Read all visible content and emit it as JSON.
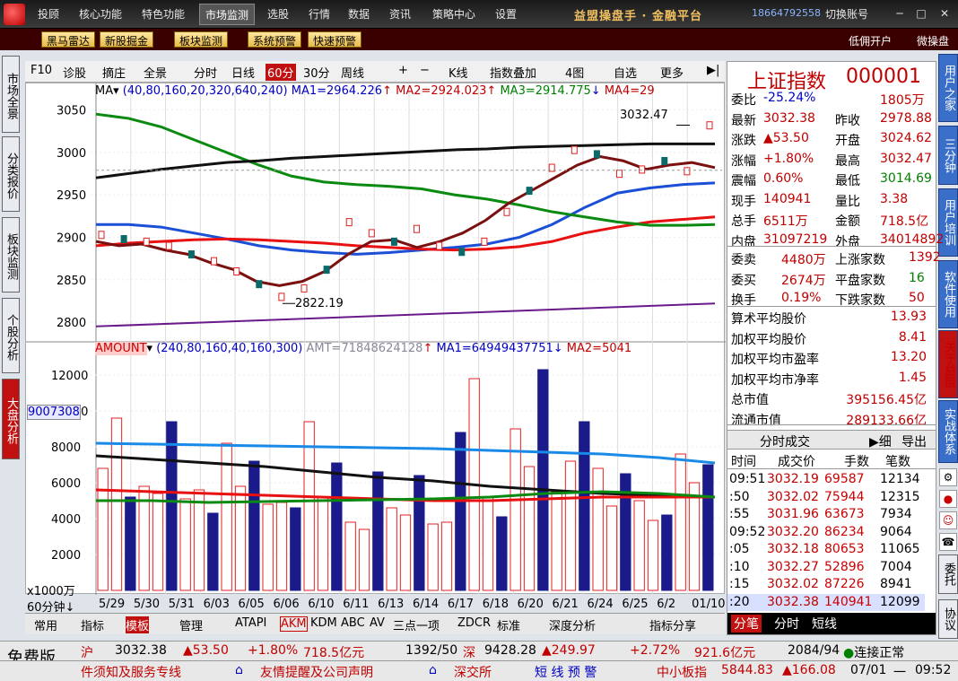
{
  "topbar": {
    "menu": [
      "投顾",
      "核心功能",
      "特色功能",
      "市场监测",
      "选股",
      "行情",
      "数据",
      "资讯",
      "策略中心",
      "设置"
    ],
    "active_index": 3,
    "brand": "益盟操盘手 · 金融平台",
    "phone": "18664792558",
    "account": "切换账号"
  },
  "bar2": {
    "buttons": [
      "黑马雷达",
      "新股掘金",
      "板块监测",
      "系统预警",
      "快速预警"
    ],
    "right": [
      "低佣开户",
      "微操盘"
    ]
  },
  "left_tabs": [
    "市场全景",
    "分类报价",
    "板块监测",
    "个股分析",
    "大盘分析"
  ],
  "right_tabs": [
    "用户之家",
    "三分钟",
    "用户培训",
    "软件使用",
    "关于益盟",
    "实战体系"
  ],
  "right_tab_bottom": [
    "委托",
    "协议"
  ],
  "toolbar": {
    "items": [
      "F10",
      "诊股",
      "摘庄",
      "全景",
      "分时",
      "日线",
      "60分",
      "30分",
      "周线",
      "+",
      "−",
      "K线",
      "指数叠加",
      "4图",
      "自选",
      "更多"
    ]
  },
  "ma_label": {
    "name": "MA",
    "params": "(40,80,160,20,320,640,240)",
    "ma1": "MA1=2964.226",
    "ma2": "MA2=2924.023",
    "ma3": "MA3=2914.775",
    "ma4": "MA4=29"
  },
  "amount_label": {
    "name": "AMOUNT",
    "params": "(240,80,160,40,160,300)",
    "amt": "AMT=71848624128",
    "ma1": "MA1=64949437751",
    "ma2": "MA2=5041"
  },
  "chart_data": [
    {
      "type": "line",
      "title": "上证指数 60分钟 K线",
      "ylim": [
        2780,
        3060
      ],
      "yticks": [
        3050,
        3000,
        2950,
        2900,
        2850,
        2800
      ],
      "annotations": {
        "high": "3032.47",
        "low": "2822.19"
      },
      "series": [
        {
          "name": "MA1",
          "values": [
            2915,
            2915,
            2912,
            2905,
            2898,
            2890,
            2885,
            2882,
            2880,
            2882,
            2885,
            2888,
            2892,
            2900,
            2915,
            2935,
            2952,
            2958,
            2962,
            2964
          ]
        },
        {
          "name": "MA2",
          "values": [
            2890,
            2893,
            2895,
            2897,
            2898,
            2897,
            2895,
            2893,
            2890,
            2888,
            2886,
            2885,
            2886,
            2889,
            2895,
            2905,
            2912,
            2918,
            2921,
            2924
          ]
        },
        {
          "name": "MA3",
          "values": [
            3045,
            3040,
            3030,
            3015,
            3000,
            2985,
            2972,
            2965,
            2962,
            2960,
            2957,
            2950,
            2945,
            2938,
            2930,
            2924,
            2918,
            2914,
            2914,
            2915
          ]
        },
        {
          "name": "MA4",
          "values": [
            2970,
            2975,
            2980,
            2984,
            2988,
            2990,
            2993,
            2995,
            2997,
            2999,
            3001,
            3003,
            3004,
            3006,
            3007,
            3008,
            3009,
            3010,
            3010,
            3010
          ]
        }
      ]
    },
    {
      "type": "bar",
      "title": "AMOUNT",
      "unit": "x1000万",
      "ylim": [
        0,
        13000
      ],
      "yticks": [
        12000,
        10000,
        8000,
        6000,
        4000,
        2000
      ],
      "readout": "9007308"
    }
  ],
  "dates": [
    "5/29",
    "5/30",
    "5/31",
    "6/03",
    "6/05",
    "6/06",
    "6/10",
    "6/11",
    "6/13",
    "6/14",
    "6/17",
    "6/18",
    "6/20",
    "6/21",
    "6/24",
    "6/25",
    "6/2",
    "01/10:00"
  ],
  "axis_unit": "x1000万",
  "period_select": "60分钟",
  "bottom_tools": [
    "常用",
    "指标",
    "模板",
    "管理",
    "ATAPI",
    "AKM",
    "KDM",
    "ABC",
    "AV",
    "三点一项",
    "ZDCR",
    "标准",
    "深度分析",
    "指标分享"
  ],
  "right_panel": {
    "title": "上证指数",
    "code": "000001",
    "rows": [
      [
        "委比",
        "-25.24%",
        "",
        "1805万"
      ],
      [
        "最新",
        "3032.38",
        "昨收",
        "2978.88"
      ],
      [
        "涨跌",
        "▲53.50",
        "开盘",
        "3024.62"
      ],
      [
        "涨幅",
        "+1.80%",
        "最高",
        "3032.47"
      ],
      [
        "震幅",
        "0.60%",
        "最低",
        "3014.69"
      ],
      [
        "现手",
        "140941",
        "量比",
        "3.38"
      ],
      [
        "总手",
        "6511万",
        "金额",
        "718.5亿"
      ],
      [
        "内盘",
        "31097219",
        "外盘",
        "34014892"
      ]
    ],
    "rows2": [
      [
        "委卖",
        "4480万",
        "上涨家数",
        "1392"
      ],
      [
        "委买",
        "2674万",
        "平盘家数",
        "16"
      ],
      [
        "换手",
        "0.19%",
        "下跌家数",
        "50"
      ]
    ],
    "rows3": [
      [
        "算术平均股价",
        "13.93"
      ],
      [
        "加权平均股价",
        "8.41"
      ],
      [
        "加权平均市盈率",
        "13.20"
      ],
      [
        "加权平均市净率",
        "1.45"
      ],
      [
        "总市值",
        "395156.45亿"
      ],
      [
        "流通市值",
        "289133.66亿"
      ]
    ],
    "trade_header": "分时成交",
    "trade_btn1": "细",
    "trade_btn2": "导出",
    "trade_cols": [
      "时间",
      "成交价",
      "手数",
      "笔数"
    ],
    "trades": [
      [
        "09:51",
        "3032.19",
        "69587",
        "12134"
      ],
      [
        ":50",
        "3032.02",
        "75944",
        "12315"
      ],
      [
        ":55",
        "3031.96",
        "63673",
        "7934"
      ],
      [
        "09:52",
        "3032.20",
        "86234",
        "9064"
      ],
      [
        ":05",
        "3032.18",
        "80653",
        "11065"
      ],
      [
        ":10",
        "3032.27",
        "52896",
        "7004"
      ],
      [
        ":15",
        "3032.02",
        "87226",
        "8941"
      ],
      [
        ":20",
        "3032.38",
        "140941",
        "12099"
      ]
    ],
    "bottom_tabs": [
      "分笔",
      "分时",
      "短线"
    ]
  },
  "status1": {
    "label": "免费版",
    "sh_name": "沪",
    "sh_price": "3032.38",
    "sh_chg": "▲53.50",
    "sh_pct": "+1.80%",
    "sh_amt": "718.5亿元",
    "sh_ud": "1392/50",
    "sz_name": "深",
    "sz_price": "9428.28",
    "sz_chg": "▲249.97",
    "sz_pct": "+2.72%",
    "sz_amt": "921.6亿元",
    "sz_ud": "2084/94",
    "conn": "连接正常"
  },
  "status2": {
    "notice": "件须知及服务专线",
    "link1": "友情提醒及公司声明",
    "link2": "深交所",
    "warn": "短 线 预 警",
    "zxb": "中小板指",
    "zxb_price": "5844.83",
    "zxb_chg": "▲166.08",
    "date": "07/01",
    "weekday": "一",
    "time": "09:52"
  }
}
